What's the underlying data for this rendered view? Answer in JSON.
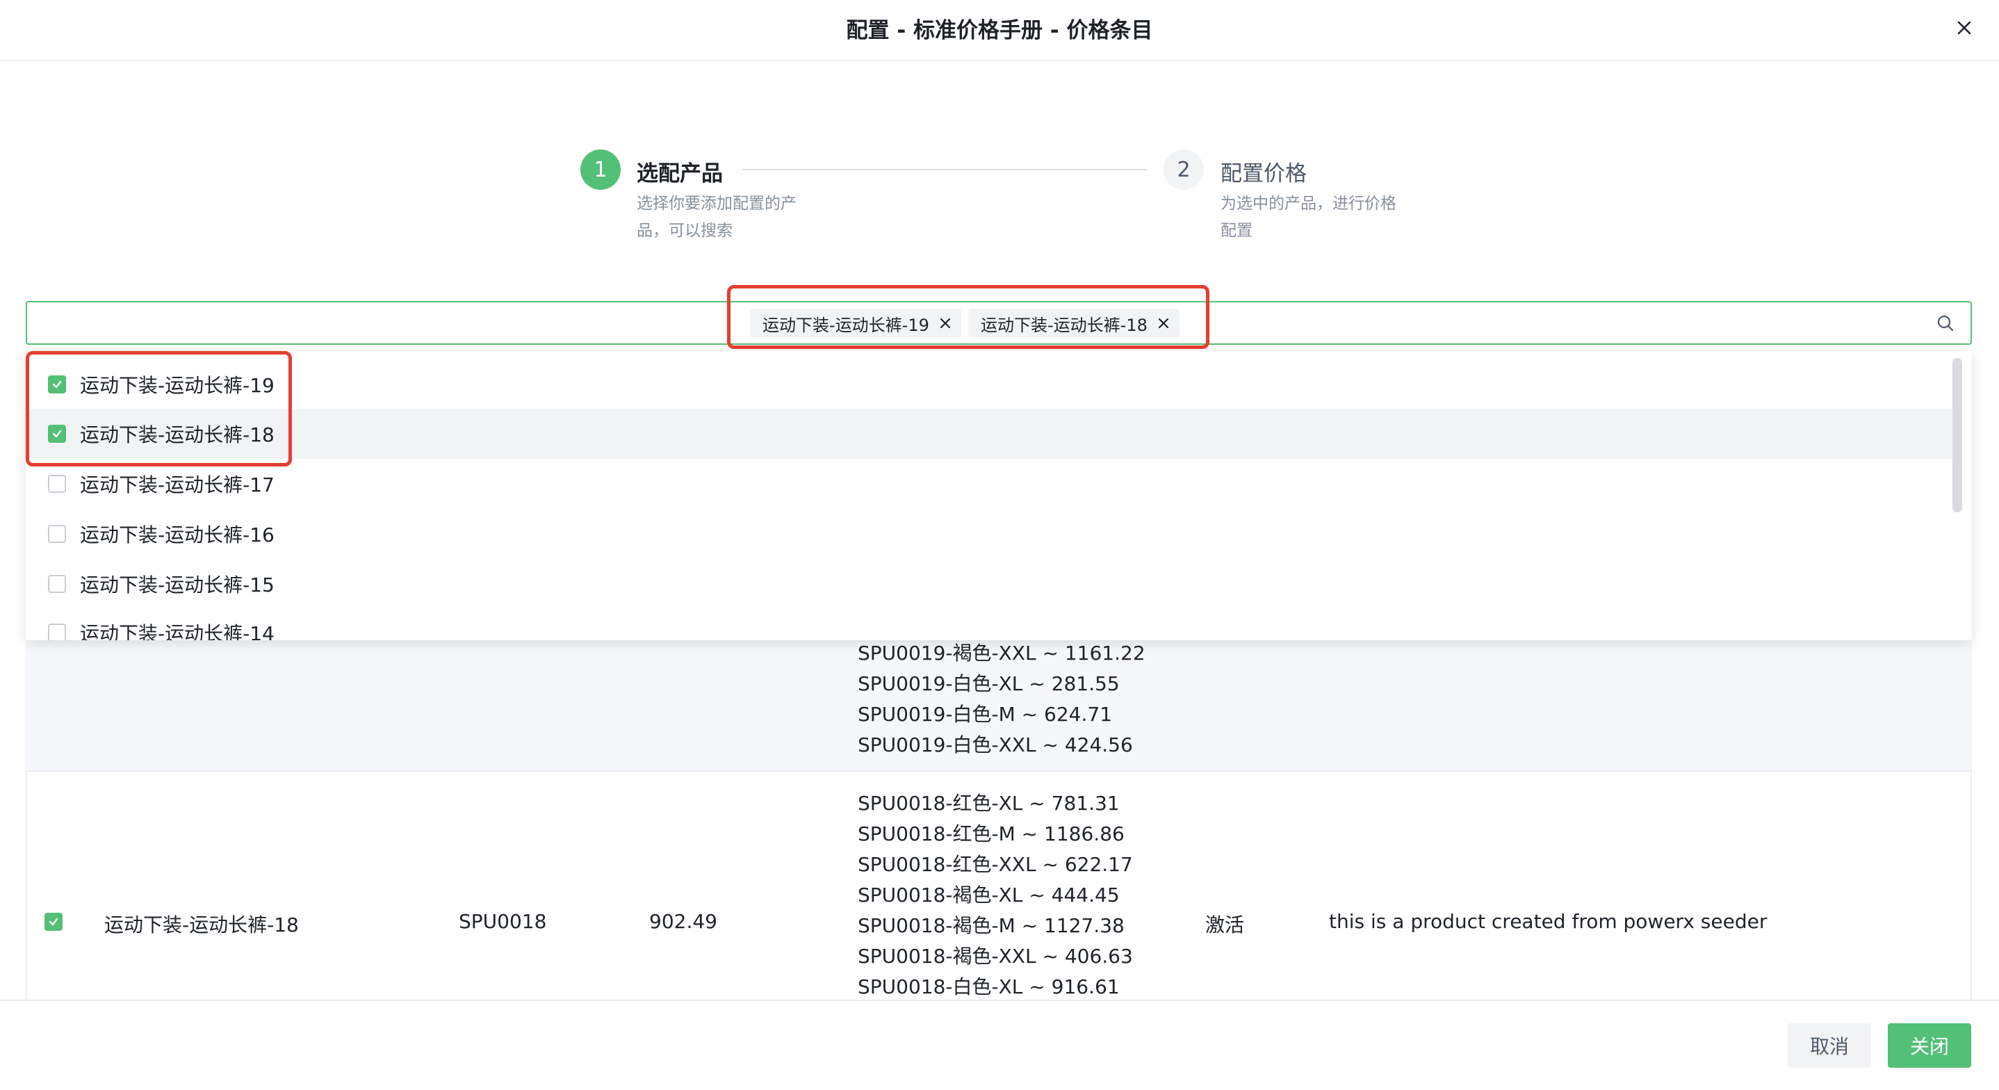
{
  "dialog": {
    "title": "配置 - 标准价格手册 - 价格条目"
  },
  "steps": [
    {
      "number": "1",
      "title": "选配产品",
      "desc_line1": "选择你要添加配置的产",
      "desc_line2": "品，可以搜索"
    },
    {
      "number": "2",
      "title": "配置价格",
      "desc_line1": "为选中的产品，进行价格",
      "desc_line2": "配置"
    }
  ],
  "select": {
    "tags": [
      "运动下装-运动长裤-19",
      "运动下装-运动长裤-18"
    ]
  },
  "dropdown": {
    "options": [
      {
        "label": "运动下装-运动长裤-19",
        "checked": true
      },
      {
        "label": "运动下装-运动长裤-18",
        "checked": true
      },
      {
        "label": "运动下装-运动长裤-17",
        "checked": false
      },
      {
        "label": "运动下装-运动长裤-16",
        "checked": false
      },
      {
        "label": "运动下装-运动长裤-15",
        "checked": false
      },
      {
        "label": "运动下装-运动长裤-14",
        "checked": false
      }
    ]
  },
  "table": {
    "prev_row_skus": [
      "SPU0019-褐色-XXL ~ 1161.22",
      "SPU0019-白色-XL ~ 281.55",
      "SPU0019-白色-M ~ 624.71",
      "SPU0019-白色-XXL ~ 424.56"
    ],
    "row": {
      "name": "运动下装-运动长裤-18",
      "spu": "SPU0018",
      "price": "902.49",
      "status": "激活",
      "description": "this is a product created from powerx seeder",
      "skus": [
        "SPU0018-红色-XL ~ 781.31",
        "SPU0018-红色-M ~ 1186.86",
        "SPU0018-红色-XXL ~ 622.17",
        "SPU0018-褐色-XL ~ 444.45",
        "SPU0018-褐色-M ~ 1127.38",
        "SPU0018-褐色-XXL ~ 406.63",
        "SPU0018-白色-XL ~ 916.61"
      ]
    }
  },
  "footer": {
    "cancel_label": "取消",
    "close_label": "关闭"
  },
  "colors": {
    "accent": "#52c076",
    "highlight": "#e53e30"
  }
}
